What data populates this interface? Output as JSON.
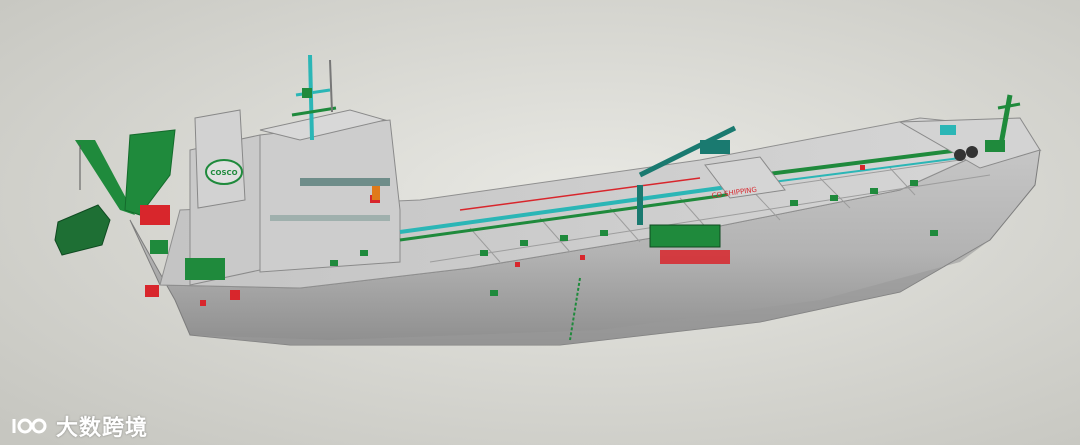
{
  "image": {
    "subject": "cosco-tanker-3d-model",
    "colors": {
      "background_light": "#e6e6e1",
      "background_dark": "#bfbfb9",
      "hull": "#b9b9b9",
      "hull_shadow": "#8f8f8f",
      "deck": "#cfcfcf",
      "equipment_green": "#1f8a3c",
      "dark_green": "#146b2c",
      "cyan": "#2bb6b6",
      "red": "#d8262c",
      "orange": "#e07a1a"
    }
  },
  "hull_marking": {
    "funnel_logo": "COSCO",
    "name_plate": "CO SHIPPING"
  },
  "watermark": {
    "text": "大数跨境",
    "logo": "100-logo-icon"
  }
}
